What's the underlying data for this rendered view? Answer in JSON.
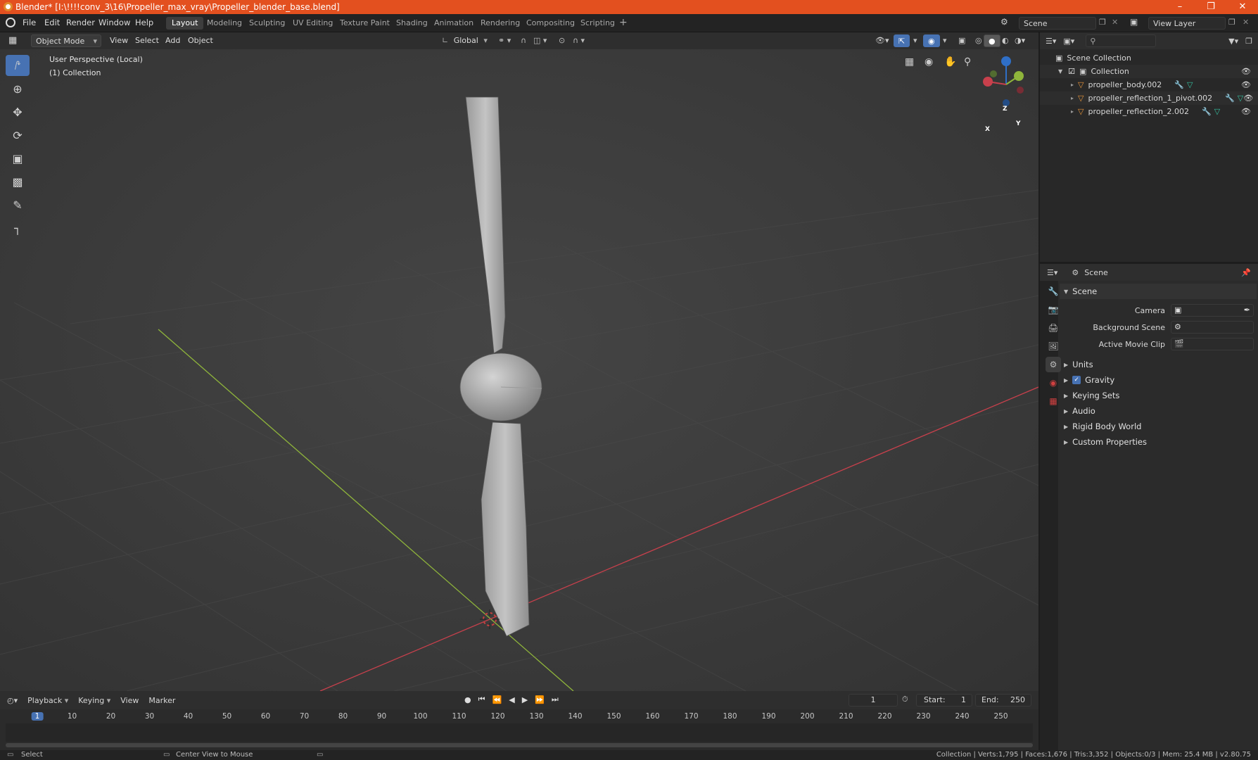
{
  "titlebar": {
    "title": "Blender* [I:\\!!!!conv_3\\16\\Propeller_max_vray\\Propeller_blender_base.blend]"
  },
  "menu": [
    "File",
    "Edit",
    "Render",
    "Window",
    "Help"
  ],
  "workspaces": [
    "Layout",
    "Modeling",
    "Sculpting",
    "UV Editing",
    "Texture Paint",
    "Shading",
    "Animation",
    "Rendering",
    "Compositing",
    "Scripting"
  ],
  "active_workspace": "Layout",
  "scene_field": "Scene",
  "view_layer_field": "View Layer",
  "viewport_header": {
    "mode": "Object Mode",
    "menus": [
      "View",
      "Select",
      "Add",
      "Object"
    ],
    "orientation": "Global"
  },
  "viewport": {
    "perspective": "User Perspective (Local)",
    "collection": "(1) Collection"
  },
  "gizmo": {
    "x": "X",
    "y": "Y",
    "z": "Z"
  },
  "outliner": {
    "root": "Scene Collection",
    "collection": "Collection",
    "objects": [
      "propeller_body.002",
      "propeller_reflection_1_pivot.002",
      "propeller_reflection_2.002"
    ]
  },
  "properties": {
    "header": "Scene",
    "section": "Scene",
    "fields": [
      "Camera",
      "Background Scene",
      "Active Movie Clip"
    ],
    "subpanels": [
      "Units",
      "Gravity",
      "Keying Sets",
      "Audio",
      "Rigid Body World",
      "Custom Properties"
    ]
  },
  "timeline": {
    "menus": [
      "Playback",
      "Keying",
      "View",
      "Marker"
    ],
    "current_frame": "1",
    "start_label": "Start:",
    "start": "1",
    "end_label": "End:",
    "end": "250",
    "ticks": [
      "1",
      "10",
      "20",
      "30",
      "40",
      "50",
      "60",
      "70",
      "80",
      "90",
      "100",
      "110",
      "120",
      "130",
      "140",
      "150",
      "160",
      "170",
      "180",
      "190",
      "200",
      "210",
      "220",
      "230",
      "240",
      "250"
    ]
  },
  "statusbar": {
    "left": "Select",
    "middle": "Center View to Mouse",
    "right": "Collection | Verts:1,795 | Faces:1,676 | Tris:3,352 | Objects:0/3 | Mem: 25.4 MB | v2.80.75"
  },
  "colors": {
    "titlebar": "#e3501f",
    "accent": "#4772b3",
    "x_axis": "#c8404c",
    "y_axis": "#8fb53b"
  }
}
